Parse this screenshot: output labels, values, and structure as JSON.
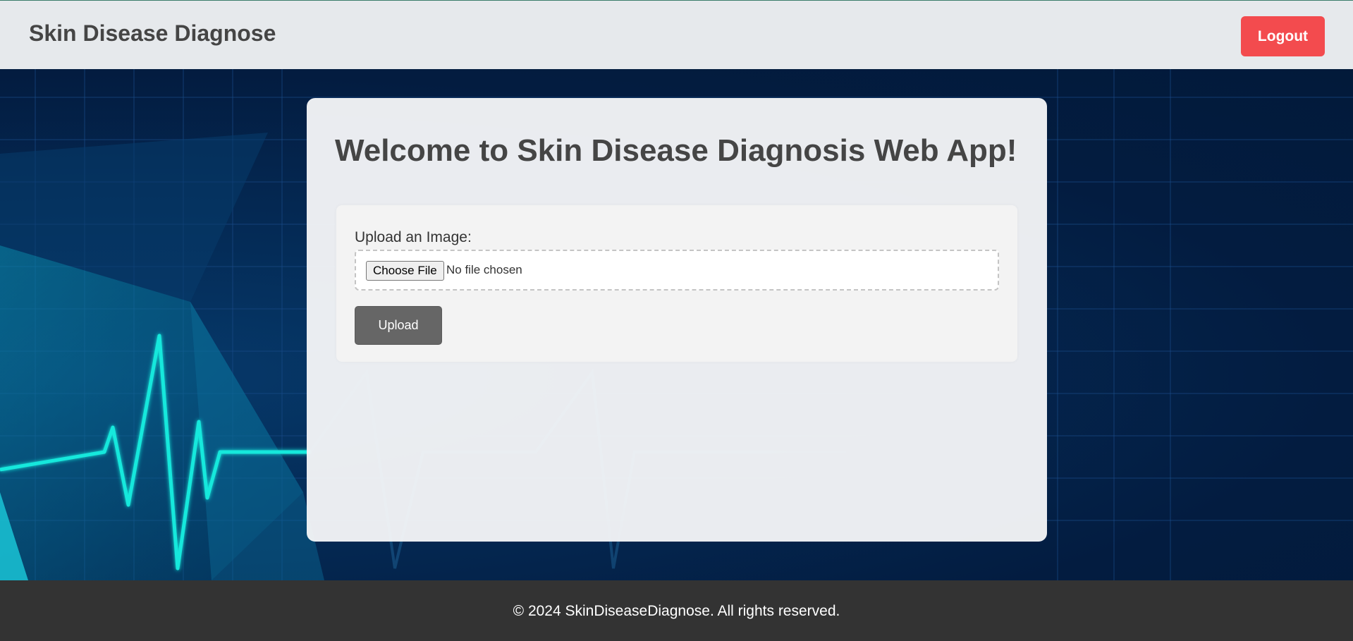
{
  "header": {
    "brand": "Skin Disease Diagnose",
    "logout_label": "Logout",
    "logout_color": "#f34b4e"
  },
  "main": {
    "welcome_title": "Welcome to Skin Disease Diagnosis Web App!",
    "upload_label": "Upload an Image:",
    "file_input": {
      "button_label": "Choose File",
      "status_text": "No file chosen"
    },
    "upload_button_label": "Upload"
  },
  "footer": {
    "text": "© 2024 SkinDiseaseDiagnose. All rights reserved."
  },
  "background": {
    "theme_colors": [
      "#021a3a",
      "#06396a",
      "#00e5e0"
    ],
    "decoration": "heartbeat-line"
  }
}
